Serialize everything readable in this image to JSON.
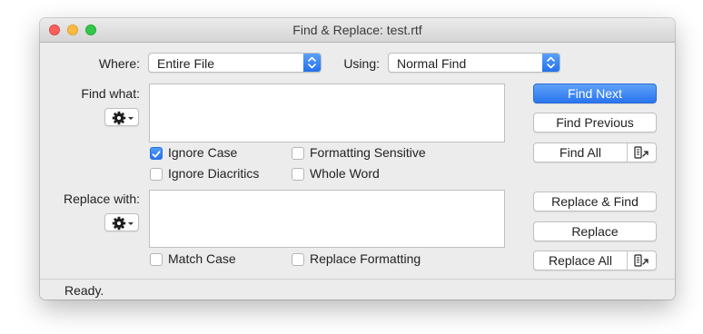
{
  "window": {
    "title": "Find & Replace: test.rtf"
  },
  "where": {
    "label": "Where:",
    "value": "Entire File"
  },
  "using": {
    "label": "Using:",
    "value": "Normal Find"
  },
  "find": {
    "label": "Find what:",
    "value": ""
  },
  "replace": {
    "label": "Replace with:",
    "value": ""
  },
  "options": {
    "ignore_case": {
      "label": "Ignore Case",
      "checked": true
    },
    "formatting_sensitive": {
      "label": "Formatting Sensitive",
      "checked": false
    },
    "ignore_diacritics": {
      "label": "Ignore Diacritics",
      "checked": false
    },
    "whole_word": {
      "label": "Whole Word",
      "checked": false
    },
    "match_case": {
      "label": "Match Case",
      "checked": false
    },
    "replace_formatting": {
      "label": "Replace Formatting",
      "checked": false
    }
  },
  "buttons": {
    "find_next": "Find Next",
    "find_previous": "Find Previous",
    "find_all": "Find All",
    "replace_and_find": "Replace & Find",
    "replace": "Replace",
    "replace_all": "Replace All"
  },
  "status": "Ready.",
  "colors": {
    "accent": "#2a74ee",
    "close": "#fc605c",
    "minimize": "#fdbc40",
    "maximize": "#34c84a"
  }
}
